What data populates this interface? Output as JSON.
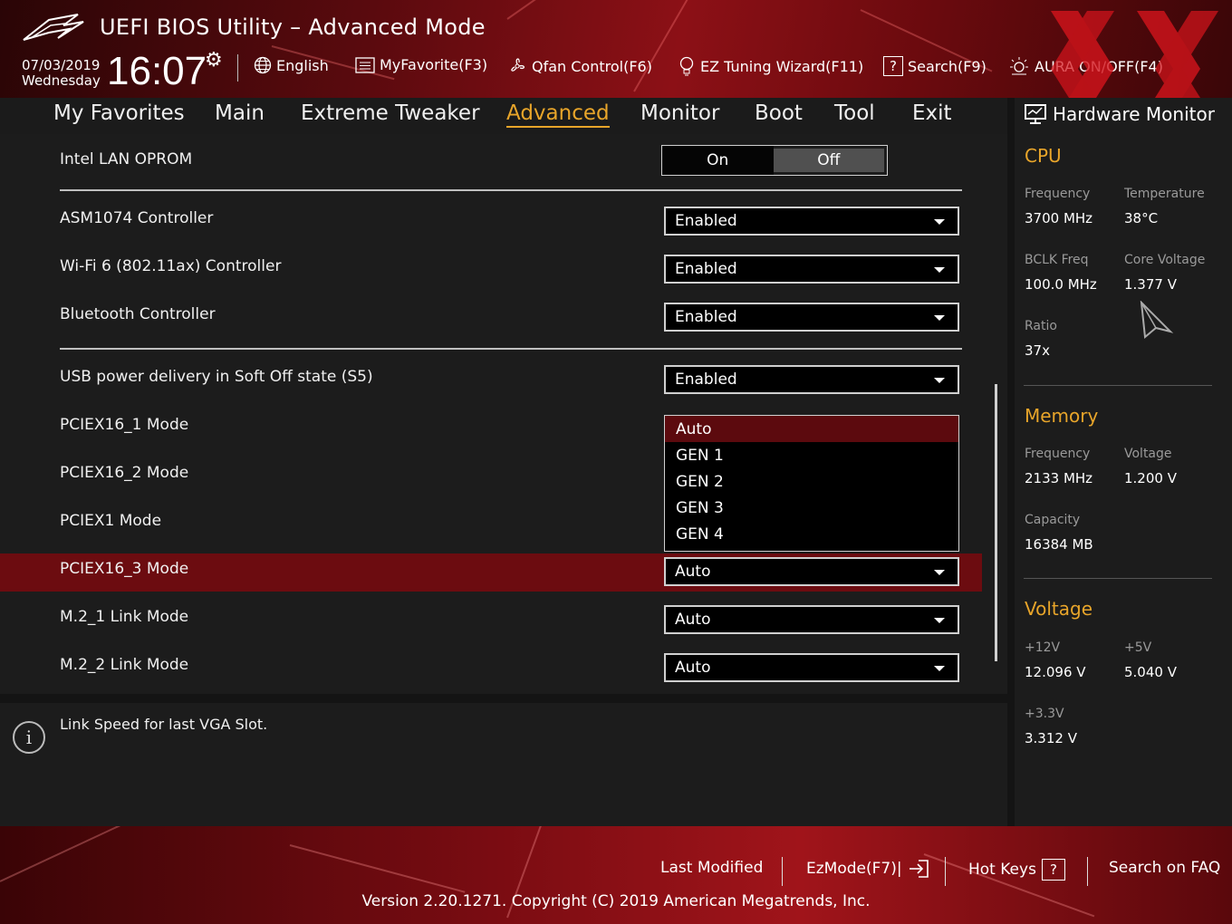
{
  "header": {
    "title": "UEFI BIOS Utility – Advanced Mode",
    "date": "07/03/2019",
    "weekday": "Wednesday",
    "time": "16:07",
    "toolbar": [
      {
        "label": "English",
        "icon": "globe-icon"
      },
      {
        "label": "MyFavorite(F3)",
        "icon": "favorite-icon"
      },
      {
        "label": "Qfan Control(F6)",
        "icon": "fan-icon"
      },
      {
        "label": "EZ Tuning Wizard(F11)",
        "icon": "bulb-icon"
      },
      {
        "label": "Search(F9)",
        "icon": "question-box-icon"
      },
      {
        "label": "AURA ON/OFF(F4)",
        "icon": "aura-icon"
      }
    ]
  },
  "nav": {
    "tabs": [
      "My Favorites",
      "Main",
      "Extreme Tweaker",
      "Advanced",
      "Monitor",
      "Boot",
      "Tool",
      "Exit"
    ],
    "active": "Advanced"
  },
  "settings": {
    "intel_lan_oprom": {
      "label": "Intel LAN OPROM",
      "on": "On",
      "off": "Off",
      "selected": "Off"
    },
    "asm1074": {
      "label": "ASM1074 Controller",
      "value": "Enabled"
    },
    "wifi6": {
      "label": "Wi-Fi 6 (802.11ax) Controller",
      "value": "Enabled"
    },
    "bluetooth": {
      "label": "Bluetooth Controller",
      "value": "Enabled"
    },
    "usb_power": {
      "label": "USB power delivery in Soft Off state (S5)",
      "value": "Enabled"
    },
    "pciex16_1": {
      "label": "PCIEX16_1 Mode"
    },
    "pciex16_2": {
      "label": "PCIEX16_2 Mode"
    },
    "pciex1": {
      "label": "PCIEX1 Mode"
    },
    "pciex16_3": {
      "label": "PCIEX16_3 Mode",
      "value": "Auto"
    },
    "m2_1": {
      "label": "M.2_1 Link Mode",
      "value": "Auto"
    },
    "m2_2": {
      "label": "M.2_2 Link Mode",
      "value": "Auto"
    }
  },
  "dropdown": {
    "options": [
      "Auto",
      "GEN 1",
      "GEN 2",
      "GEN 3",
      "GEN 4"
    ],
    "selected": "Auto"
  },
  "help": {
    "text": "Link Speed for last VGA Slot."
  },
  "hw_monitor": {
    "title": "Hardware Monitor",
    "cpu": {
      "heading": "CPU",
      "frequency_label": "Frequency",
      "frequency": "3700 MHz",
      "temperature_label": "Temperature",
      "temperature": "38°C",
      "bclk_label": "BCLK Freq",
      "bclk": "100.0 MHz",
      "core_voltage_label": "Core Voltage",
      "core_voltage": "1.377 V",
      "ratio_label": "Ratio",
      "ratio": "37x"
    },
    "memory": {
      "heading": "Memory",
      "frequency_label": "Frequency",
      "frequency": "2133 MHz",
      "voltage_label": "Voltage",
      "voltage": "1.200 V",
      "capacity_label": "Capacity",
      "capacity": "16384 MB"
    },
    "voltage": {
      "heading": "Voltage",
      "v12_label": "+12V",
      "v12": "12.096 V",
      "v5_label": "+5V",
      "v5": "5.040 V",
      "v33_label": "+3.3V",
      "v33": "3.312 V"
    }
  },
  "footer": {
    "last_modified": "Last Modified",
    "ezmode": "EzMode(F7)|",
    "hot_keys": "Hot Keys",
    "search_faq": "Search on FAQ",
    "version": "Version 2.20.1271. Copyright (C) 2019 American Megatrends, Inc."
  },
  "colors": {
    "accent": "#e8a52a",
    "highlight_row": "#6c0c10",
    "header_red": "#8c1016",
    "panel": "#1c1c1c"
  }
}
